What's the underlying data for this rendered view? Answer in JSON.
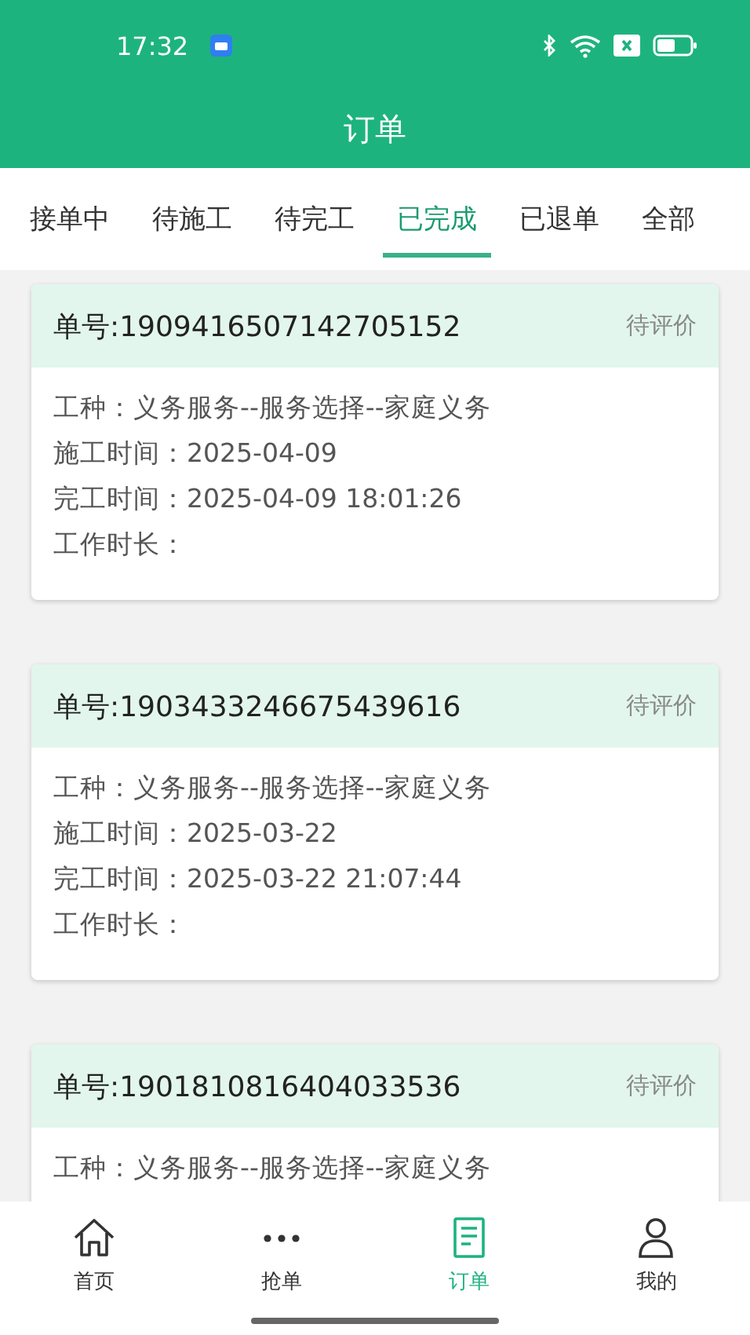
{
  "status_bar": {
    "time": "17:32"
  },
  "header": {
    "title": "订单"
  },
  "tabs": [
    {
      "label": "接单中",
      "selected": false
    },
    {
      "label": "待施工",
      "selected": false
    },
    {
      "label": "待完工",
      "selected": false
    },
    {
      "label": "已完成",
      "selected": true
    },
    {
      "label": "已退单",
      "selected": false
    },
    {
      "label": "全部",
      "selected": false
    }
  ],
  "orders": [
    {
      "number": "单号:1909416507142705152",
      "status": "待评价",
      "lines": [
        "工种：义务服务--服务选择--家庭义务",
        "施工时间：2025-04-09",
        "完工时间：2025-04-09 18:01:26",
        "工作时长："
      ]
    },
    {
      "number": "单号:1903433246675439616",
      "status": "待评价",
      "lines": [
        "工种：义务服务--服务选择--家庭义务",
        "施工时间：2025-03-22",
        "完工时间：2025-03-22 21:07:44",
        "工作时长："
      ]
    },
    {
      "number": "单号:1901810816404033536",
      "status": "待评价",
      "lines": [
        "工种：义务服务--服务选择--家庭义务"
      ]
    }
  ],
  "bottom_nav": [
    {
      "kind": "home",
      "label": "首页",
      "selected": false
    },
    {
      "kind": "more",
      "label": "抢单",
      "selected": false
    },
    {
      "kind": "list",
      "label": "订单",
      "selected": true
    },
    {
      "kind": "user",
      "label": "我的",
      "selected": false
    }
  ]
}
